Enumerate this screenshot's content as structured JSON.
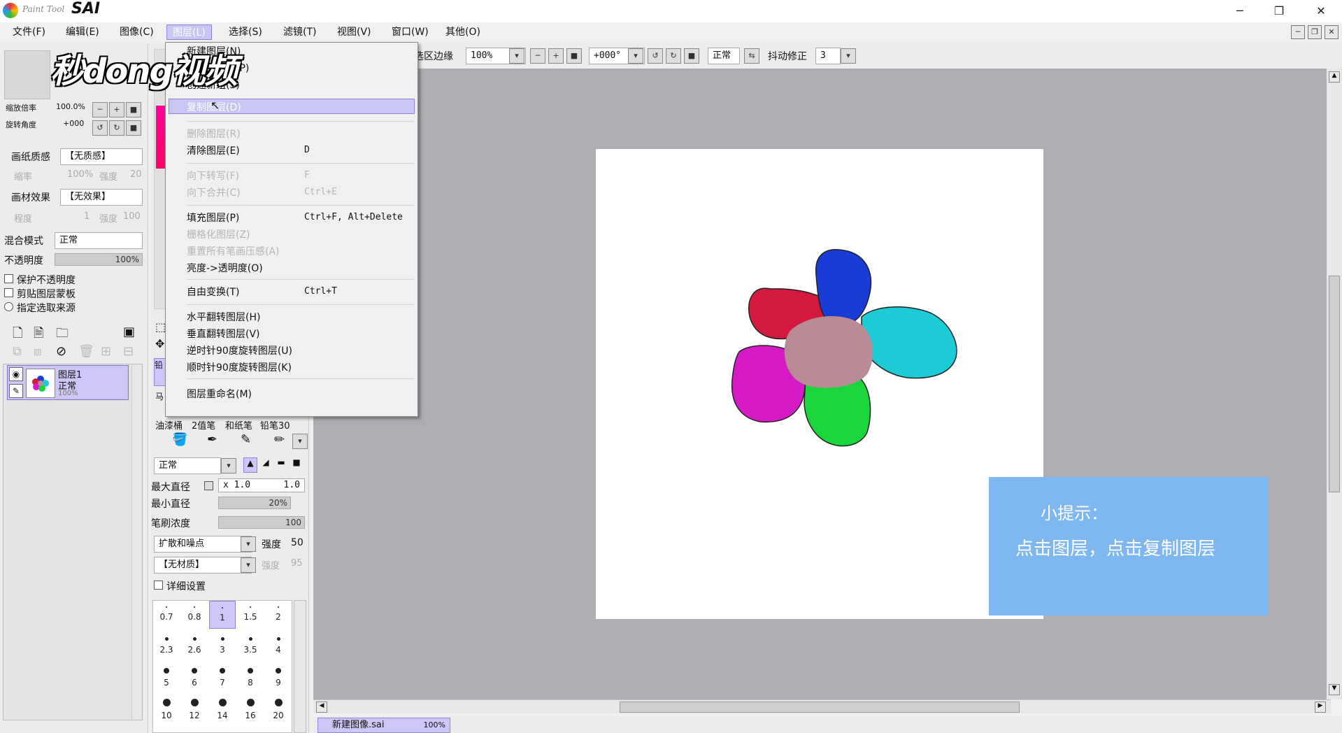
{
  "titlebar": {
    "logo_small": "Paint Tool",
    "logo_text": "SAI",
    "minimize": "─",
    "restore": "❐",
    "close": "✕"
  },
  "menubar": {
    "items": [
      "文件(F)",
      "编辑(E)",
      "图像(C)",
      "图层(L)",
      "选择(S)",
      "滤镜(T)",
      "视图(V)",
      "窗口(W)",
      "其他(O)"
    ],
    "active": "图层(L)"
  },
  "toolbar": {
    "selection_edge": "选区边缘",
    "zoom": "100%",
    "rotation": "+000°",
    "blend": "正常",
    "stabilizer_label": "抖动修正",
    "stabilizer": "3"
  },
  "navigator": {
    "zoom_label": "缩放倍率",
    "zoom_value": "100.0%",
    "rotate_label": "旋转角度",
    "rotate_value": "+000"
  },
  "left_panel": {
    "paper_texture_label": "画纸质感",
    "paper_texture_value": "【无质感】",
    "scale_label": "缩率",
    "scale_value": "100%",
    "strength_label": "强度",
    "strength_value": "20",
    "material_effect_label": "画材效果",
    "material_effect_value": "【无效果】",
    "degree_label": "程度",
    "degree_value": "1",
    "strength2_label": "强度",
    "strength2_value": "100",
    "blend_mode_label": "混合模式",
    "blend_mode_value": "正常",
    "opacity_label": "不透明度",
    "opacity_value": "100%",
    "protect_opacity": "保护不透明度",
    "clipping_mask": "剪贴图层蒙板",
    "selection_source": "指定选取来源"
  },
  "layer": {
    "name": "图层1",
    "mode": "正常",
    "opacity": "100%"
  },
  "dropdown": {
    "items": [
      {
        "label": "新建图层(N)",
        "shortcut": "",
        "dim": false
      },
      {
        "label": "新建图层组(P)",
        "shortcut": "",
        "dim": false
      },
      {
        "label": "创建新组(S)",
        "shortcut": "",
        "dim": false
      },
      {
        "label": "复制图层(D)",
        "shortcut": "",
        "dim": false,
        "highlight": true
      },
      {
        "label": "删除图层(R)",
        "shortcut": "",
        "dim": true
      },
      {
        "label": "清除图层(E)",
        "shortcut": "D",
        "dim": false
      },
      {
        "label": "向下转写(F)",
        "shortcut": "F",
        "dim": true
      },
      {
        "label": "向下合并(C)",
        "shortcut": "Ctrl+E",
        "dim": true
      },
      {
        "label": "填充图层(P)",
        "shortcut": "Ctrl+F, Alt+Delete",
        "dim": false
      },
      {
        "label": "栅格化图层(Z)",
        "shortcut": "",
        "dim": true
      },
      {
        "label": "重置所有笔画压感(A)",
        "shortcut": "",
        "dim": true
      },
      {
        "label": "亮度->透明度(O)",
        "shortcut": "",
        "dim": false
      },
      {
        "label": "自由变换(T)",
        "shortcut": "Ctrl+T",
        "dim": false
      },
      {
        "label": "水平翻转图层(H)",
        "shortcut": "",
        "dim": false
      },
      {
        "label": "垂直翻转图层(V)",
        "shortcut": "",
        "dim": false
      },
      {
        "label": "逆时针90度旋转图层(U)",
        "shortcut": "",
        "dim": false
      },
      {
        "label": "顺时针90度旋转图层(K)",
        "shortcut": "",
        "dim": false
      },
      {
        "label": "图层重命名(M)",
        "shortcut": "",
        "dim": false
      }
    ]
  },
  "tools": {
    "brushes": [
      "油漆桶",
      "2值笔",
      "和纸笔",
      "铅笔30"
    ],
    "blend": "正常",
    "max_size_label": "最大直径",
    "max_size_mult": "x 1.0",
    "max_size_value": "1.0",
    "min_size_label": "最小直径",
    "min_size_value": "20%",
    "density_label": "笔刷浓度",
    "density_value": "100",
    "shape_label": "扩散和噪点",
    "shape_strength_label": "强度",
    "shape_strength_value": "50",
    "texture_label": "【无材质】",
    "texture_strength_label": "强度",
    "texture_strength_value": "95",
    "advanced_label": "详细设置",
    "sizes": [
      "0.7",
      "0.8",
      "1",
      "1.5",
      "2",
      "2.3",
      "2.6",
      "3",
      "3.5",
      "4",
      "5",
      "6",
      "7",
      "8",
      "9",
      "10",
      "12",
      "14",
      "16",
      "20"
    ]
  },
  "watermark": "秒dong视频",
  "tip": {
    "title": "小提示：",
    "text": "点击图层，点击复制图层"
  },
  "status": {
    "doc_name": "新建图像.sai",
    "doc_zoom": "100%"
  },
  "colors": {
    "menu_highlight": "#c9c6f5",
    "canvas_bg": "#afadb2",
    "tip_bg": "#7fb8f0",
    "petal_red": "#d4193f",
    "petal_blue": "#1a3cd6",
    "petal_cyan": "#1dcbd6",
    "petal_magenta": "#d61ac6",
    "petal_green": "#1ad63c",
    "center": "#b88b95"
  }
}
